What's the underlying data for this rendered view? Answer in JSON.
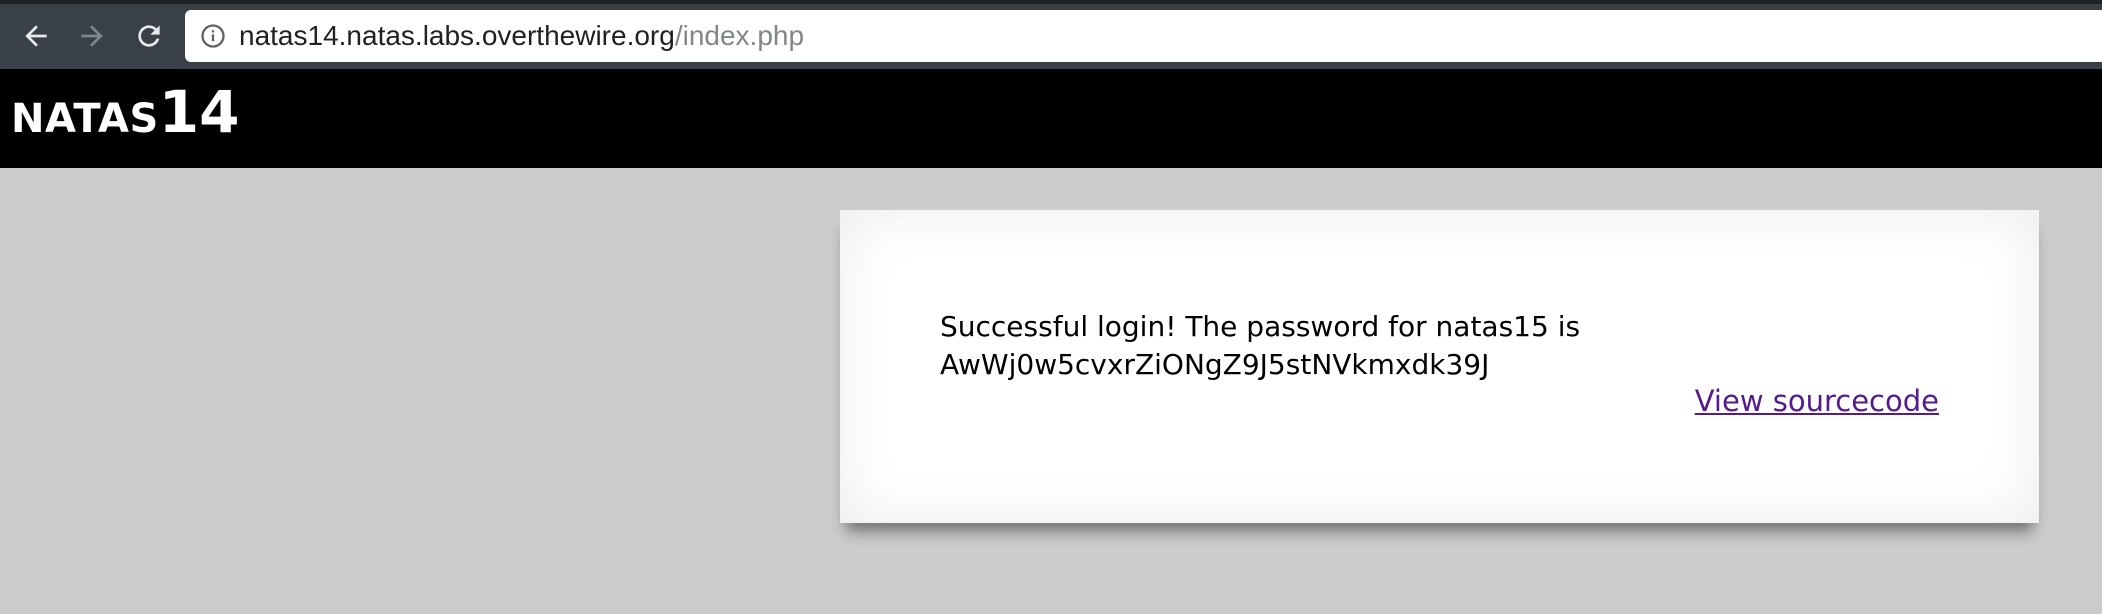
{
  "browser": {
    "url_host": "natas14.natas.labs.overthewire.org",
    "url_path": "/index.php",
    "back_icon": "arrow-left-icon",
    "forward_icon": "arrow-right-icon",
    "reload_icon": "reload-icon",
    "info_icon": "info-circle-icon"
  },
  "header": {
    "logo_word": "NATAS",
    "logo_number": "14"
  },
  "content": {
    "message_line1": "Successful login! The password for natas15 is",
    "message_line2": "AwWj0w5cvxrZiONgZ9J5stNVkmxdk39J",
    "view_source_label": "View sourcecode"
  },
  "colors": {
    "page_background": "#cccccc",
    "header_background": "#000000",
    "link_visited": "#551a8b",
    "toolbar": "#3a4047"
  }
}
